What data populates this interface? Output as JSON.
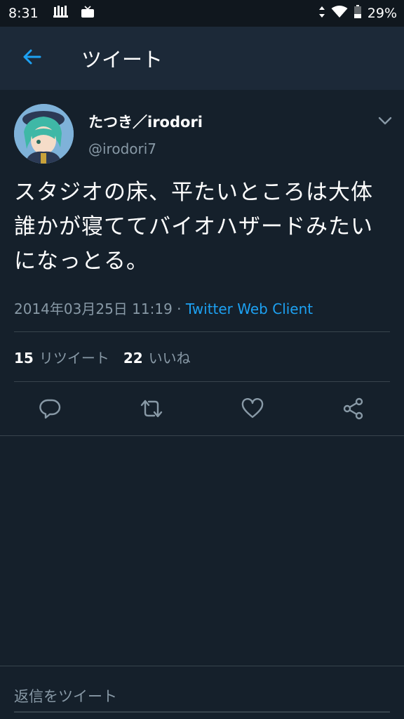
{
  "status_bar": {
    "time": "8:31",
    "battery": "29%"
  },
  "app_bar": {
    "title": "ツイート"
  },
  "tweet": {
    "display_name": "たつき／irodori",
    "handle": "@irodori7",
    "text": "スタジオの床、平たいところは大体誰かが寝ててバイオハザードみたいになっとる。",
    "timestamp": "2014年03月25日 11:19",
    "separator": "·",
    "client": "Twitter Web Client",
    "retweet_count": "15",
    "retweet_label": "リツイート",
    "like_count": "22",
    "like_label": "いいね"
  },
  "reply": {
    "placeholder": "返信をツイート"
  },
  "colors": {
    "background": "#15202b",
    "app_bar": "#1c2938",
    "accent": "#1da1f2",
    "secondary_text": "#8899a6",
    "divider": "#38444d"
  },
  "icons": {
    "back": "arrow-left-icon",
    "caret": "chevron-down-icon",
    "reply": "reply-icon",
    "retweet": "retweet-icon",
    "like": "heart-icon",
    "share": "share-icon"
  }
}
